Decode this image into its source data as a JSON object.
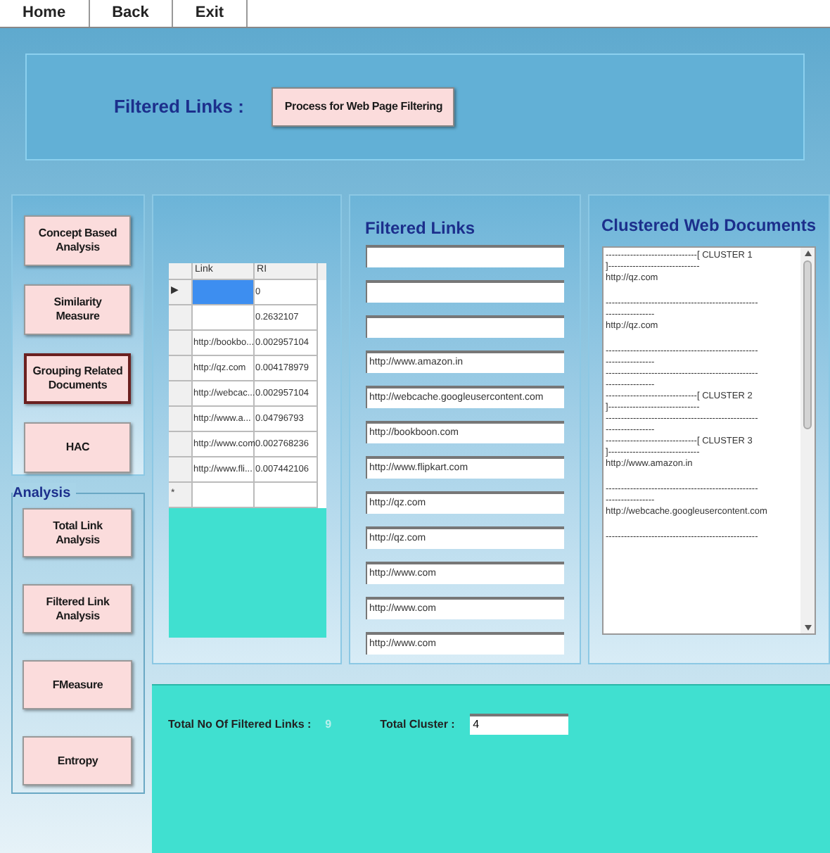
{
  "menu": [
    {
      "label": "Home"
    },
    {
      "label": "Back"
    },
    {
      "label": "Exit"
    }
  ],
  "header": {
    "label": "Filtered Links :",
    "button": "Process for Web Page Filtering"
  },
  "sidebar": {
    "buttons": [
      {
        "label": "Concept Based Analysis",
        "selected": false
      },
      {
        "label": "Similarity Measure",
        "selected": false
      },
      {
        "label": "Grouping Related Documents",
        "selected": true
      },
      {
        "label": "HAC",
        "selected": false
      }
    ],
    "analysis": {
      "title": "Analysis",
      "buttons": [
        {
          "label": "Total Link Analysis"
        },
        {
          "label": "Filtered Link Analysis"
        },
        {
          "label": "FMeasure"
        },
        {
          "label": "Entropy"
        }
      ]
    }
  },
  "table": {
    "columns": [
      "Link",
      "RI"
    ],
    "rows": [
      {
        "marker": "▶",
        "ri": "0",
        "selected": true
      },
      {
        "ri": "0.2632107",
        "selected": false
      },
      {
        "link": "http://bookbo...",
        "ri": "0.002957104",
        "selected": false
      },
      {
        "link": "http://qz.com",
        "ri": "0.004178979",
        "selected": false
      },
      {
        "link": "http://webcac...",
        "ri": "0.002957104",
        "selected": false
      },
      {
        "link": "http://www.a...",
        "ri": "0.04796793",
        "selected": false
      },
      {
        "link": "http://www.com",
        "ri": "0.002768236",
        "selected": false
      },
      {
        "link": "http://www.fli...",
        "ri": "0.007442106",
        "selected": false
      },
      {
        "marker": "*",
        "selected": false
      }
    ]
  },
  "filtered_links": {
    "title": "Filtered Links",
    "fields": [
      {
        "kind": "empty"
      },
      {
        "kind": "empty"
      },
      {
        "kind": "empty"
      },
      {
        "kind": "link",
        "value": "http://www.amazon.in"
      },
      {
        "kind": "link",
        "value": "http://webcache.googleusercontent.com"
      },
      {
        "kind": "link",
        "value": "http://bookboon.com"
      },
      {
        "kind": "link",
        "value": "http://www.flipkart.com"
      },
      {
        "kind": "link",
        "value": "http://qz.com"
      },
      {
        "kind": "link",
        "value": "http://qz.com"
      },
      {
        "kind": "link",
        "value": "http://www.com"
      },
      {
        "kind": "link",
        "value": "http://www.com"
      },
      {
        "kind": "link",
        "value": "http://www.com"
      }
    ]
  },
  "clusters": {
    "title": "Clustered Web Documents",
    "paragraphs": [
      [
        "------------------------------[ CLUSTER 1",
        "]------------------------------",
        "http://qz.com"
      ],
      [
        "--------------------------------------------------",
        "----------------",
        "http://qz.com"
      ],
      [
        "--------------------------------------------------",
        "----------------",
        "--------------------------------------------------",
        "----------------",
        "------------------------------[ CLUSTER 2",
        "]------------------------------",
        "--------------------------------------------------",
        "----------------",
        "------------------------------[ CLUSTER 3",
        "]------------------------------",
        "http://www.amazon.in"
      ],
      [
        "--------------------------------------------------",
        "----------------",
        "http://webcache.googleusercontent.com"
      ],
      [
        "--------------------------------------------------"
      ]
    ]
  },
  "summary": {
    "links_label": "Total No Of Filtered Links :",
    "links_value": "9",
    "cluster_label": "Total Cluster :",
    "cluster_value": "4"
  }
}
